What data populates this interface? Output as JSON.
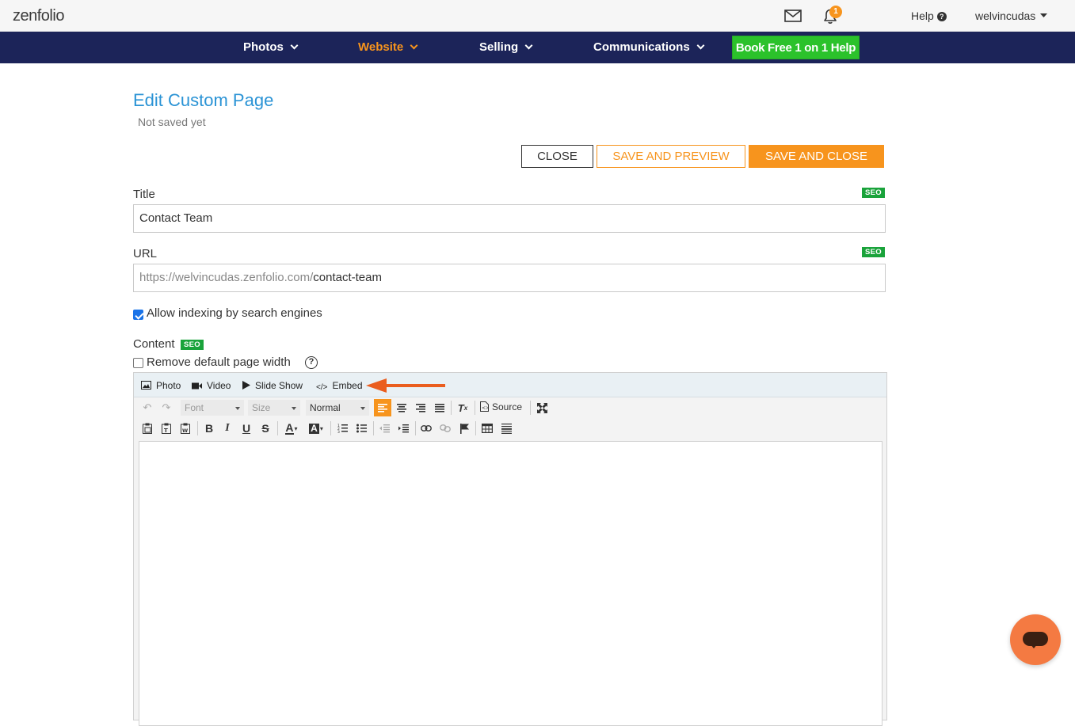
{
  "topbar": {
    "logo": "zenfolio",
    "notification_count": "1",
    "help_label": "Help",
    "username": "welvincudas"
  },
  "nav": {
    "items": [
      {
        "label": "Photos"
      },
      {
        "label": "Website"
      },
      {
        "label": "Selling"
      },
      {
        "label": "Communications"
      }
    ],
    "active": "Website",
    "book_help": "Book Free 1 on 1 Help"
  },
  "page": {
    "title": "Edit Custom Page",
    "status": "Not saved yet"
  },
  "actions": {
    "close": "CLOSE",
    "save_preview": "SAVE AND PREVIEW",
    "save_close": "SAVE AND CLOSE"
  },
  "form": {
    "seo_badge": "SEO",
    "title_label": "Title",
    "title_value": "Contact Team",
    "url_label": "URL",
    "url_prefix": "https://welvincudas.zenfolio.com/",
    "url_value": "contact-team",
    "allow_indexing_label": "Allow indexing by search engines",
    "allow_indexing_checked": true,
    "content_label": "Content",
    "remove_width_label": "Remove default page width",
    "remove_width_checked": false
  },
  "editor": {
    "insert": {
      "photo": "Photo",
      "video": "Video",
      "slideshow": "Slide Show",
      "embed": "Embed"
    },
    "font_placeholder": "Font",
    "size_placeholder": "Size",
    "format_value": "Normal",
    "source_label": "Source"
  },
  "colors": {
    "nav_bg": "#1c2459",
    "accent_orange": "#f7941d",
    "title_blue": "#2a93d5",
    "seo_green": "#1aa33b",
    "book_green": "#2bc22b",
    "annotation_arrow": "#ea5d1e",
    "chat_bg": "#f47a42"
  },
  "icons": [
    "envelope-icon",
    "bell-icon",
    "help-circle-icon",
    "caret-down-icon",
    "photo-icon",
    "video-camera-icon",
    "play-icon",
    "code-icon",
    "undo-icon",
    "redo-icon",
    "align-left-icon",
    "align-center-icon",
    "align-right-icon",
    "justify-icon",
    "clear-format-icon",
    "source-icon",
    "maximize-icon",
    "paste-icon",
    "paste-text-icon",
    "paste-word-icon",
    "bold-icon",
    "italic-icon",
    "underline-icon",
    "strikethrough-icon",
    "text-color-icon",
    "background-color-icon",
    "numbered-list-icon",
    "bulleted-list-icon",
    "outdent-icon",
    "indent-icon",
    "link-icon",
    "unlink-icon",
    "anchor-flag-icon",
    "table-icon",
    "horizontal-line-icon",
    "chat-icon"
  ]
}
